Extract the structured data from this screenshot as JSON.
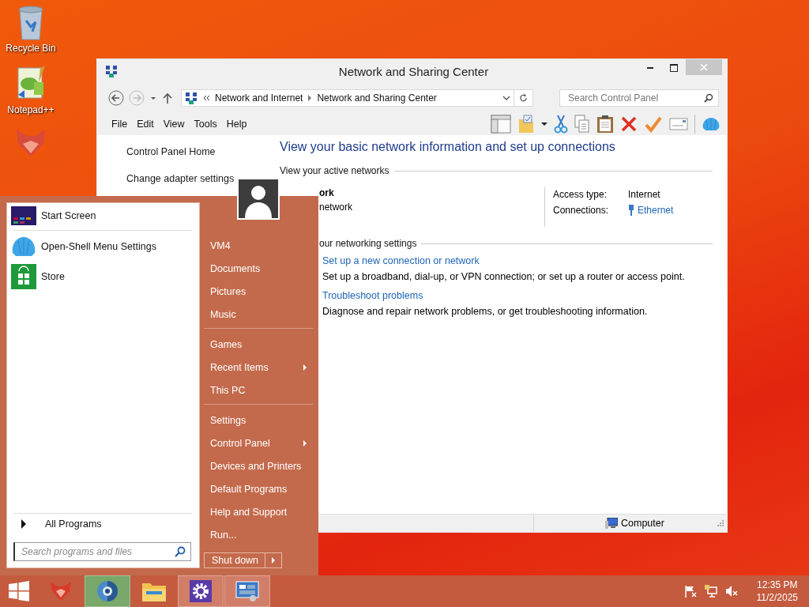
{
  "desktop_icons": [
    {
      "label": "Recycle Bin",
      "kind": "bin"
    },
    {
      "label": "Notepad++",
      "kind": "notepad"
    },
    {
      "kind": "fox"
    }
  ],
  "window": {
    "title": "Network and Sharing Center",
    "address": {
      "path": [
        "Network and Internet",
        "Network and Sharing Center"
      ]
    },
    "search": {
      "placeholder": "Search Control Panel"
    },
    "menu": [
      "File",
      "Edit",
      "View",
      "Tools",
      "Help"
    ],
    "sidebar": {
      "items": [
        "Control Panel Home",
        "Change adapter settings"
      ]
    },
    "heading": "View your basic network information and set up connections",
    "active_networks_label": "View your active networks",
    "network": {
      "name": "ork",
      "type": "network"
    },
    "access": [
      {
        "label": "Access type:",
        "value": "Internet",
        "kind": "text"
      },
      {
        "label": "Connections:",
        "value": "Ethernet",
        "kind": "link"
      }
    ],
    "settings_label": "our networking settings",
    "tasks": [
      {
        "link": "Set up a new connection or network",
        "description": "Set up a broadband, dial-up, or VPN connection; or set up a router or access point."
      },
      {
        "link": "Troubleshoot problems",
        "description": "Diagnose and repair network problems, or get troubleshooting information."
      }
    ],
    "status_bar": {
      "computer": "Computer"
    }
  },
  "start_menu": {
    "pinned": [
      {
        "label": "Start Screen",
        "kind": "start"
      },
      {
        "label": "Open-Shell Menu Settings",
        "kind": "shell"
      },
      {
        "label": "Store",
        "kind": "store"
      }
    ],
    "all_programs": "All Programs",
    "search": {
      "placeholder": "Search programs and files"
    },
    "places": [
      [
        {
          "label": "VM4",
          "submenu": false
        },
        {
          "label": "Documents",
          "submenu": false
        },
        {
          "label": "Pictures",
          "submenu": false
        },
        {
          "label": "Music",
          "submenu": false
        }
      ],
      [
        {
          "label": "Games",
          "submenu": false
        },
        {
          "label": "Recent Items",
          "submenu": true
        },
        {
          "label": "This PC",
          "submenu": false
        }
      ],
      [
        {
          "label": "Settings",
          "submenu": false
        },
        {
          "label": "Control Panel",
          "submenu": true
        },
        {
          "label": "Devices and Printers",
          "submenu": false
        },
        {
          "label": "Default Programs",
          "submenu": false
        },
        {
          "label": "Help and Support",
          "submenu": false
        },
        {
          "label": "Run...",
          "submenu": false
        }
      ]
    ],
    "shutdown": "Shut down"
  },
  "taskbar": {
    "apps": [
      {
        "kind": "fox",
        "active": false
      },
      {
        "kind": "browser",
        "active": true
      },
      {
        "kind": "folder",
        "active": false
      },
      {
        "kind": "gear",
        "active": true
      },
      {
        "kind": "control-panel",
        "active": true
      }
    ],
    "time": "12:35 PM",
    "date": "11/2/2025"
  }
}
